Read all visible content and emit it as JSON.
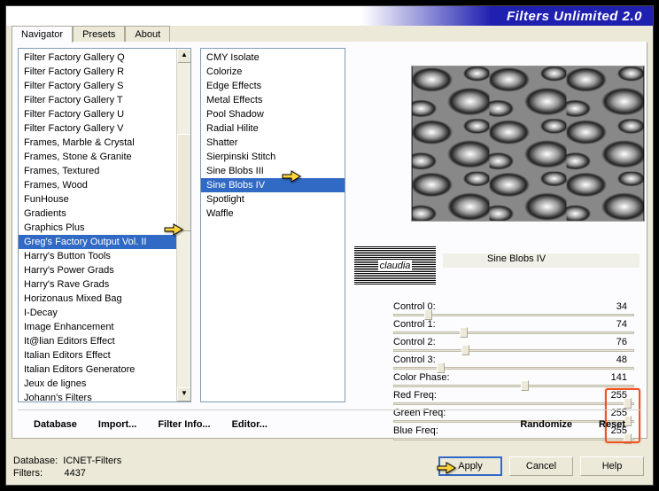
{
  "header": {
    "title": "Filters Unlimited 2.0"
  },
  "tabs": [
    "Navigator",
    "Presets",
    "About"
  ],
  "categories": [
    "Filter Factory Gallery Q",
    "Filter Factory Gallery R",
    "Filter Factory Gallery S",
    "Filter Factory Gallery T",
    "Filter Factory Gallery U",
    "Filter Factory Gallery V",
    "Frames, Marble & Crystal",
    "Frames, Stone & Granite",
    "Frames, Textured",
    "Frames, Wood",
    "FunHouse",
    "Gradients",
    "Graphics Plus",
    "Greg's Factory Output Vol. II",
    "Harry's Button Tools",
    "Harry's Power Grads",
    "Harry's Rave Grads",
    "Horizonaus Mixed Bag",
    "I-Decay",
    "Image Enhancement",
    "It@lian Editors Effect",
    "Italian Editors Effect",
    "Italian Editors Generatore",
    "Jeux de lignes",
    "Johann's Filters"
  ],
  "categories_selected": 13,
  "filters": [
    "CMY Isolate",
    "Colorize",
    "Edge Effects",
    "Metal Effects",
    "Pool Shadow",
    "Radial Hilite",
    "Shatter",
    "Sierpinski Stitch",
    "Sine Blobs III",
    "Sine Blobs IV",
    "Spotlight",
    "Waffle"
  ],
  "filters_selected": 9,
  "logo": "claudia",
  "filter_name": "Sine Blobs IV",
  "sliders": [
    {
      "label": "Control 0:",
      "value": 34,
      "max": 255
    },
    {
      "label": "Control 1:",
      "value": 74,
      "max": 255
    },
    {
      "label": "Control 2:",
      "value": 76,
      "max": 255
    },
    {
      "label": "Control 3:",
      "value": 48,
      "max": 255
    },
    {
      "label": "Color Phase:",
      "value": 141,
      "max": 255
    },
    {
      "label": "Red Freq:",
      "value": 255,
      "max": 255
    },
    {
      "label": "Green Freq:",
      "value": 255,
      "max": 255
    },
    {
      "label": "Blue Freq:",
      "value": 255,
      "max": 255
    }
  ],
  "links": {
    "database": "Database",
    "import": "Import...",
    "filter_info": "Filter Info...",
    "editor": "Editor...",
    "randomize": "Randomize",
    "reset": "Reset"
  },
  "status": {
    "db_label": "Database:",
    "db_val": "ICNET-Filters",
    "f_label": "Filters:",
    "f_val": "4437"
  },
  "buttons": {
    "apply": "Apply",
    "cancel": "Cancel",
    "help": "Help"
  }
}
